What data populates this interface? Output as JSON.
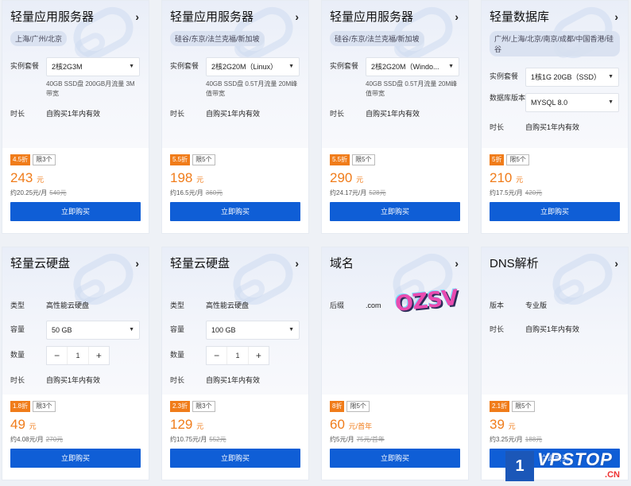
{
  "cards": [
    {
      "title": "轻量应用服务器",
      "region": "上海/广州/北京",
      "plan_label": "实例套餐",
      "plan_value": "2核2G3M",
      "plan_desc": "40GB SSD盘 200GB月流量 3M带宽",
      "duration_label": "时长",
      "duration_value": "自购买1年内有效",
      "discount": "4.5折",
      "limit": "限3个",
      "price": "243",
      "unit": "元",
      "monthly": "约20.25元/月",
      "original": "540元",
      "buy": "立即购买"
    },
    {
      "title": "轻量应用服务器",
      "region": "硅谷/东京/法兰克福/新加坡",
      "plan_label": "实例套餐",
      "plan_value": "2核2G20M（Linux）",
      "plan_desc": "40GB SSD盘 0.5T月流量 20M峰值带宽",
      "duration_label": "时长",
      "duration_value": "自购买1年内有效",
      "discount": "5.5折",
      "limit": "限5个",
      "price": "198",
      "unit": "元",
      "monthly": "约16.5元/月",
      "original": "360元",
      "buy": "立即购买"
    },
    {
      "title": "轻量应用服务器",
      "region": "硅谷/东京/法兰克福/新加坡",
      "plan_label": "实例套餐",
      "plan_value": "2核2G20M（Windo...",
      "plan_desc": "40GB SSD盘 0.5T月流量 20M峰值带宽",
      "duration_label": "时长",
      "duration_value": "自购买1年内有效",
      "discount": "5.5折",
      "limit": "限5个",
      "price": "290",
      "unit": "元",
      "monthly": "约24.17元/月",
      "original": "528元",
      "buy": "立即购买"
    },
    {
      "title": "轻量数据库",
      "region": "广州/上海/北京/南京/成都/中国香港/硅谷",
      "plan_label": "实例套餐",
      "plan_value": "1核1G 20GB（SSD）",
      "version_label": "数据库版本",
      "version_value": "MYSQL 8.0",
      "duration_label": "时长",
      "duration_value": "自购买1年内有效",
      "discount": "5折",
      "limit": "限5个",
      "price": "210",
      "unit": "元",
      "monthly": "约17.5元/月",
      "original": "420元",
      "buy": "立即购买"
    },
    {
      "title": "轻量云硬盘",
      "type_label": "类型",
      "type_value": "高性能云硬盘",
      "cap_label": "容量",
      "cap_value": "50 GB",
      "qty_label": "数量",
      "qty_value": "1",
      "duration_label": "时长",
      "duration_value": "自购买1年内有效",
      "discount": "1.8折",
      "limit": "限3个",
      "price": "49",
      "unit": "元",
      "monthly": "约4.08元/月",
      "original": "270元",
      "buy": "立即购买"
    },
    {
      "title": "轻量云硬盘",
      "type_label": "类型",
      "type_value": "高性能云硬盘",
      "cap_label": "容量",
      "cap_value": "100 GB",
      "qty_label": "数量",
      "qty_value": "1",
      "duration_label": "时长",
      "duration_value": "自购买1年内有效",
      "discount": "2.3折",
      "limit": "限3个",
      "price": "129",
      "unit": "元",
      "monthly": "约10.75元/月",
      "original": "552元",
      "buy": "立即购买"
    },
    {
      "title": "域名",
      "suffix_label": "后缀",
      "suffix_value": ".com",
      "discount": "8折",
      "limit": "限5个",
      "price": "60",
      "unit": "元/首年",
      "monthly": "约5元/月",
      "original": "75元/首年",
      "buy": "立即购买"
    },
    {
      "title": "DNS解析",
      "edition_label": "版本",
      "edition_value": "专业版",
      "duration_label": "时长",
      "duration_value": "自购买1年内有效",
      "discount": "2.1折",
      "limit": "限5个",
      "price": "39",
      "unit": "元",
      "monthly": "约3.25元/月",
      "original": "188元",
      "buy": "立即购买"
    }
  ],
  "watermarks": {
    "ozsv": "OZSV",
    "vpstop": "VPSTOP",
    "cn": ".CN",
    "num": "1"
  }
}
